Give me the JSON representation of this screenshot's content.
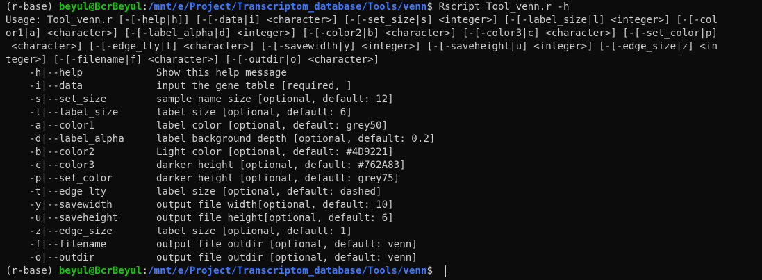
{
  "prompt": {
    "env": "(r-base) ",
    "user_host": "beyul@BcrBeyul",
    "colon": ":",
    "path": "/mnt/e/Project/Transcriptom_database/Tools/venn",
    "dollar": "$ "
  },
  "command": "Rscript Tool_venn.r -h",
  "usage_lines": [
    "Usage: Tool_venn.r [-[-help|h]] [-[-data|i] <character>] [-[-set_size|s] <integer>] [-[-label_size|l] <integer>] [-[-col",
    "or1|a] <character>] [-[-label_alpha|d] <integer>] [-[-color2|b] <character>] [-[-color3|c] <character>] [-[-set_color|p]",
    " <character>] [-[-edge_lty|t] <character>] [-[-savewidth|y] <integer>] [-[-saveheight|u] <integer>] [-[-edge_size|z] <in",
    "teger>] [-[-filename|f] <character>] [-[-outdir|o] <character>]"
  ],
  "options": [
    {
      "flag": "    -h|--help",
      "desc": "Show this help message"
    },
    {
      "flag": "    -i|--data",
      "desc": "input the gene table [required, ]"
    },
    {
      "flag": "    -s|--set_size",
      "desc": "sample name size [optional, default: 12]"
    },
    {
      "flag": "    -l|--label_size",
      "desc": "label size [optional, default: 6]"
    },
    {
      "flag": "    -a|--color1",
      "desc": "label color [optional, default: grey50]"
    },
    {
      "flag": "    -d|--label_alpha",
      "desc": "label background depth [optional, default: 0.2]"
    },
    {
      "flag": "    -b|--color2",
      "desc": "Light color [optional, default: #4D9221]"
    },
    {
      "flag": "    -c|--color3",
      "desc": "darker height [optional, default: #762A83]"
    },
    {
      "flag": "    -p|--set_color",
      "desc": "darker height [optional, default: grey75]"
    },
    {
      "flag": "    -t|--edge_lty",
      "desc": "label size [optional, default: dashed]"
    },
    {
      "flag": "    -y|--savewidth",
      "desc": "output file width[optional, default: 10]"
    },
    {
      "flag": "    -u|--saveheight",
      "desc": "output file height[optional, default: 6]"
    },
    {
      "flag": "    -z|--edge_size",
      "desc": "label size [optional, default: 1]"
    },
    {
      "flag": "    -f|--filename",
      "desc": "output file outdir [optional, default: venn]"
    },
    {
      "flag": "    -o|--outdir",
      "desc": "output file outdir [optional, default: venn]"
    }
  ],
  "colors": {
    "background": "#0c0c0c",
    "text": "#cccccc",
    "user_host": "#16c60c",
    "path": "#3b78ff"
  }
}
